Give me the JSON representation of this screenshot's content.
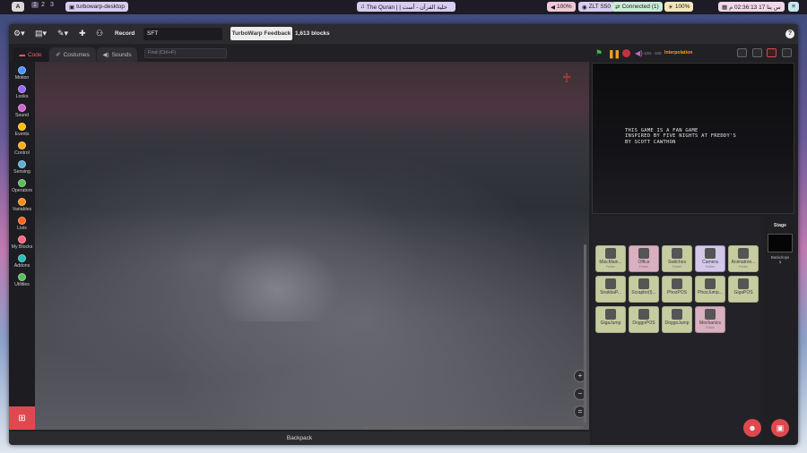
{
  "taskbar": {
    "launcher_label": "A",
    "workspaces": [
      "1",
      "2",
      "3"
    ],
    "active_app": "turbowarp-desktop",
    "media": "The Quran | | حلية القرآن - أست",
    "volume": "100%",
    "network": "ZLT S50",
    "connection": "Connected (1)",
    "brightness": "100%",
    "clock": "س يتا 17 02:36:13 م",
    "end_icon": "≡"
  },
  "menubar": {
    "record_label": "Record",
    "project_title": "SFT",
    "feedback_label": "TurboWarp Feedback",
    "blocks_count": "1,613 blocks",
    "help_label": "?"
  },
  "tabs": [
    {
      "label": "Code",
      "icon": "code-icon"
    },
    {
      "label": "Costumes",
      "icon": "brush-icon"
    },
    {
      "label": "Sounds",
      "icon": "speaker-icon"
    }
  ],
  "find": {
    "placeholder": "Find (Ctrl+F)"
  },
  "categories": [
    {
      "label": "Motion",
      "color": "#4c97ff"
    },
    {
      "label": "Looks",
      "color": "#9966ff"
    },
    {
      "label": "Sound",
      "color": "#cf63cf"
    },
    {
      "label": "Events",
      "color": "#ffbf00"
    },
    {
      "label": "Control",
      "color": "#ffab19"
    },
    {
      "label": "Sensing",
      "color": "#5cb1d6"
    },
    {
      "label": "Operators",
      "color": "#59c059"
    },
    {
      "label": "Variables",
      "color": "#ff8c1a"
    },
    {
      "label": "Lists",
      "color": "#ff661a"
    },
    {
      "label": "My Blocks",
      "color": "#ff6680"
    },
    {
      "label": "Addons",
      "color": "#29beb8"
    },
    {
      "label": "Utilities",
      "color": "#59c059"
    }
  ],
  "workspace": {
    "zoom_in": "+",
    "zoom_out": "−",
    "zoom_reset": "="
  },
  "backpack_label": "Backpack",
  "stage_controls": {
    "volume_text": "-100, -100",
    "interpolation_label": "Interpolation"
  },
  "stage_text": "THIS GAME IS A FAN GAME\nINSPIRED BY FIVE NIGHTS AT FREDDY'S\nBY SCOTT CAWTHON",
  "sprites": [
    {
      "name": "MiscMain...",
      "sub": "Folder",
      "style": "normal"
    },
    {
      "name": "Office",
      "sub": "Folder",
      "style": "pink"
    },
    {
      "name": "Switches",
      "sub": "Folder",
      "style": "normal"
    },
    {
      "name": "Camera",
      "sub": "Folder",
      "style": "sel"
    },
    {
      "name": "Animatron...",
      "sub": "Folder",
      "style": "normal"
    },
    {
      "name": "SnakbaP...",
      "sub": "",
      "style": "normal"
    },
    {
      "name": "Scrapbo(I)...",
      "sub": "",
      "style": "normal"
    },
    {
      "name": "PhozPOS",
      "sub": "",
      "style": "normal"
    },
    {
      "name": "PhozJump...",
      "sub": "",
      "style": "normal"
    },
    {
      "name": "GigaPOS",
      "sub": "",
      "style": "normal"
    },
    {
      "name": "GigaJump",
      "sub": "",
      "style": "normal"
    },
    {
      "name": "DoggoPOS",
      "sub": "",
      "style": "normal"
    },
    {
      "name": "DoggoJump",
      "sub": "",
      "style": "normal"
    },
    {
      "name": "Mechanics",
      "sub": "Folder",
      "style": "pink"
    }
  ],
  "stage_pane": {
    "title": "Stage",
    "backdrops_label": "Backdrops",
    "backdrops_count": "1"
  }
}
